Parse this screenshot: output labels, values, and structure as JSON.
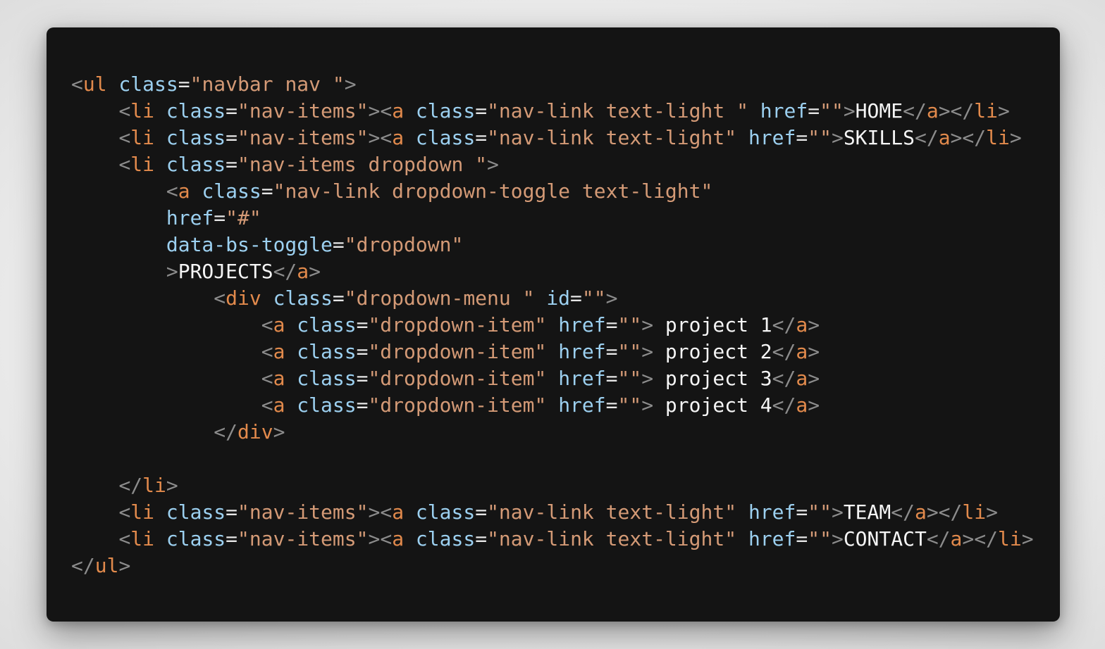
{
  "code": {
    "lines": [
      [
        [
          "punct",
          "<"
        ],
        [
          "tag",
          "ul"
        ],
        [
          "text",
          " "
        ],
        [
          "attr",
          "class"
        ],
        [
          "eq",
          "="
        ],
        [
          "val",
          "\"navbar nav \""
        ],
        [
          "punct",
          ">"
        ]
      ],
      [
        [
          "text",
          "    "
        ],
        [
          "punct",
          "<"
        ],
        [
          "tag",
          "li"
        ],
        [
          "text",
          " "
        ],
        [
          "attr",
          "class"
        ],
        [
          "eq",
          "="
        ],
        [
          "val",
          "\"nav-items\""
        ],
        [
          "punct",
          "><"
        ],
        [
          "tag",
          "a"
        ],
        [
          "text",
          " "
        ],
        [
          "attr",
          "class"
        ],
        [
          "eq",
          "="
        ],
        [
          "val",
          "\"nav-link text-light \""
        ],
        [
          "text",
          " "
        ],
        [
          "attr",
          "href"
        ],
        [
          "eq",
          "="
        ],
        [
          "val",
          "\"\""
        ],
        [
          "punct",
          ">"
        ],
        [
          "text",
          "HOME"
        ],
        [
          "punct",
          "</"
        ],
        [
          "tag",
          "a"
        ],
        [
          "punct",
          "></"
        ],
        [
          "tag",
          "li"
        ],
        [
          "punct",
          ">"
        ]
      ],
      [
        [
          "text",
          "    "
        ],
        [
          "punct",
          "<"
        ],
        [
          "tag",
          "li"
        ],
        [
          "text",
          " "
        ],
        [
          "attr",
          "class"
        ],
        [
          "eq",
          "="
        ],
        [
          "val",
          "\"nav-items\""
        ],
        [
          "punct",
          "><"
        ],
        [
          "tag",
          "a"
        ],
        [
          "text",
          " "
        ],
        [
          "attr",
          "class"
        ],
        [
          "eq",
          "="
        ],
        [
          "val",
          "\"nav-link text-light\""
        ],
        [
          "text",
          " "
        ],
        [
          "attr",
          "href"
        ],
        [
          "eq",
          "="
        ],
        [
          "val",
          "\"\""
        ],
        [
          "punct",
          ">"
        ],
        [
          "text",
          "SKILLS"
        ],
        [
          "punct",
          "</"
        ],
        [
          "tag",
          "a"
        ],
        [
          "punct",
          "></"
        ],
        [
          "tag",
          "li"
        ],
        [
          "punct",
          ">"
        ]
      ],
      [
        [
          "text",
          "    "
        ],
        [
          "punct",
          "<"
        ],
        [
          "tag",
          "li"
        ],
        [
          "text",
          " "
        ],
        [
          "attr",
          "class"
        ],
        [
          "eq",
          "="
        ],
        [
          "val",
          "\"nav-items dropdown \""
        ],
        [
          "punct",
          ">"
        ]
      ],
      [
        [
          "text",
          "        "
        ],
        [
          "punct",
          "<"
        ],
        [
          "tag",
          "a"
        ],
        [
          "text",
          " "
        ],
        [
          "attr",
          "class"
        ],
        [
          "eq",
          "="
        ],
        [
          "val",
          "\"nav-link dropdown-toggle text-light\""
        ]
      ],
      [
        [
          "text",
          "        "
        ],
        [
          "attr",
          "href"
        ],
        [
          "eq",
          "="
        ],
        [
          "val",
          "\"#\""
        ]
      ],
      [
        [
          "text",
          "        "
        ],
        [
          "attr",
          "data-bs-toggle"
        ],
        [
          "eq",
          "="
        ],
        [
          "val",
          "\"dropdown\""
        ]
      ],
      [
        [
          "text",
          "        "
        ],
        [
          "punct",
          ">"
        ],
        [
          "text",
          "PROJECTS"
        ],
        [
          "punct",
          "</"
        ],
        [
          "tag",
          "a"
        ],
        [
          "punct",
          ">"
        ]
      ],
      [
        [
          "text",
          "            "
        ],
        [
          "punct",
          "<"
        ],
        [
          "tag",
          "div"
        ],
        [
          "text",
          " "
        ],
        [
          "attr",
          "class"
        ],
        [
          "eq",
          "="
        ],
        [
          "val",
          "\"dropdown-menu \""
        ],
        [
          "text",
          " "
        ],
        [
          "attr",
          "id"
        ],
        [
          "eq",
          "="
        ],
        [
          "val",
          "\"\""
        ],
        [
          "punct",
          ">"
        ]
      ],
      [
        [
          "text",
          "                "
        ],
        [
          "punct",
          "<"
        ],
        [
          "tag",
          "a"
        ],
        [
          "text",
          " "
        ],
        [
          "attr",
          "class"
        ],
        [
          "eq",
          "="
        ],
        [
          "val",
          "\"dropdown-item\""
        ],
        [
          "text",
          " "
        ],
        [
          "attr",
          "href"
        ],
        [
          "eq",
          "="
        ],
        [
          "val",
          "\"\""
        ],
        [
          "punct",
          ">"
        ],
        [
          "text",
          " project 1"
        ],
        [
          "punct",
          "</"
        ],
        [
          "tag",
          "a"
        ],
        [
          "punct",
          ">"
        ]
      ],
      [
        [
          "text",
          "                "
        ],
        [
          "punct",
          "<"
        ],
        [
          "tag",
          "a"
        ],
        [
          "text",
          " "
        ],
        [
          "attr",
          "class"
        ],
        [
          "eq",
          "="
        ],
        [
          "val",
          "\"dropdown-item\""
        ],
        [
          "text",
          " "
        ],
        [
          "attr",
          "href"
        ],
        [
          "eq",
          "="
        ],
        [
          "val",
          "\"\""
        ],
        [
          "punct",
          ">"
        ],
        [
          "text",
          " project 2"
        ],
        [
          "punct",
          "</"
        ],
        [
          "tag",
          "a"
        ],
        [
          "punct",
          ">"
        ]
      ],
      [
        [
          "text",
          "                "
        ],
        [
          "punct",
          "<"
        ],
        [
          "tag",
          "a"
        ],
        [
          "text",
          " "
        ],
        [
          "attr",
          "class"
        ],
        [
          "eq",
          "="
        ],
        [
          "val",
          "\"dropdown-item\""
        ],
        [
          "text",
          " "
        ],
        [
          "attr",
          "href"
        ],
        [
          "eq",
          "="
        ],
        [
          "val",
          "\"\""
        ],
        [
          "punct",
          ">"
        ],
        [
          "text",
          " project 3"
        ],
        [
          "punct",
          "</"
        ],
        [
          "tag",
          "a"
        ],
        [
          "punct",
          ">"
        ]
      ],
      [
        [
          "text",
          "                "
        ],
        [
          "punct",
          "<"
        ],
        [
          "tag",
          "a"
        ],
        [
          "text",
          " "
        ],
        [
          "attr",
          "class"
        ],
        [
          "eq",
          "="
        ],
        [
          "val",
          "\"dropdown-item\""
        ],
        [
          "text",
          " "
        ],
        [
          "attr",
          "href"
        ],
        [
          "eq",
          "="
        ],
        [
          "val",
          "\"\""
        ],
        [
          "punct",
          ">"
        ],
        [
          "text",
          " project 4"
        ],
        [
          "punct",
          "</"
        ],
        [
          "tag",
          "a"
        ],
        [
          "punct",
          ">"
        ]
      ],
      [
        [
          "text",
          "            "
        ],
        [
          "punct",
          "</"
        ],
        [
          "tag",
          "div"
        ],
        [
          "punct",
          ">"
        ]
      ],
      [],
      [
        [
          "text",
          "    "
        ],
        [
          "punct",
          "</"
        ],
        [
          "tag",
          "li"
        ],
        [
          "punct",
          ">"
        ]
      ],
      [
        [
          "text",
          "    "
        ],
        [
          "punct",
          "<"
        ],
        [
          "tag",
          "li"
        ],
        [
          "text",
          " "
        ],
        [
          "attr",
          "class"
        ],
        [
          "eq",
          "="
        ],
        [
          "val",
          "\"nav-items\""
        ],
        [
          "punct",
          "><"
        ],
        [
          "tag",
          "a"
        ],
        [
          "text",
          " "
        ],
        [
          "attr",
          "class"
        ],
        [
          "eq",
          "="
        ],
        [
          "val",
          "\"nav-link text-light\""
        ],
        [
          "text",
          " "
        ],
        [
          "attr",
          "href"
        ],
        [
          "eq",
          "="
        ],
        [
          "val",
          "\"\""
        ],
        [
          "punct",
          ">"
        ],
        [
          "text",
          "TEAM"
        ],
        [
          "punct",
          "</"
        ],
        [
          "tag",
          "a"
        ],
        [
          "punct",
          "></"
        ],
        [
          "tag",
          "li"
        ],
        [
          "punct",
          ">"
        ]
      ],
      [
        [
          "text",
          "    "
        ],
        [
          "punct",
          "<"
        ],
        [
          "tag",
          "li"
        ],
        [
          "text",
          " "
        ],
        [
          "attr",
          "class"
        ],
        [
          "eq",
          "="
        ],
        [
          "val",
          "\"nav-items\""
        ],
        [
          "punct",
          "><"
        ],
        [
          "tag",
          "a"
        ],
        [
          "text",
          " "
        ],
        [
          "attr",
          "class"
        ],
        [
          "eq",
          "="
        ],
        [
          "val",
          "\"nav-link text-light\""
        ],
        [
          "text",
          " "
        ],
        [
          "attr",
          "href"
        ],
        [
          "eq",
          "="
        ],
        [
          "val",
          "\"\""
        ],
        [
          "punct",
          ">"
        ],
        [
          "text",
          "CONTACT"
        ],
        [
          "punct",
          "</"
        ],
        [
          "tag",
          "a"
        ],
        [
          "punct",
          "></"
        ],
        [
          "tag",
          "li"
        ],
        [
          "punct",
          ">"
        ]
      ],
      [
        [
          "punct",
          "</"
        ],
        [
          "tag",
          "ul"
        ],
        [
          "punct",
          ">"
        ]
      ]
    ]
  },
  "colors": {
    "background": "#141414",
    "punctuation": "#8c8c8c",
    "tag": "#e28a4c",
    "attribute": "#9cd0f0",
    "string": "#d49a76",
    "text": "#f5f5f5"
  }
}
